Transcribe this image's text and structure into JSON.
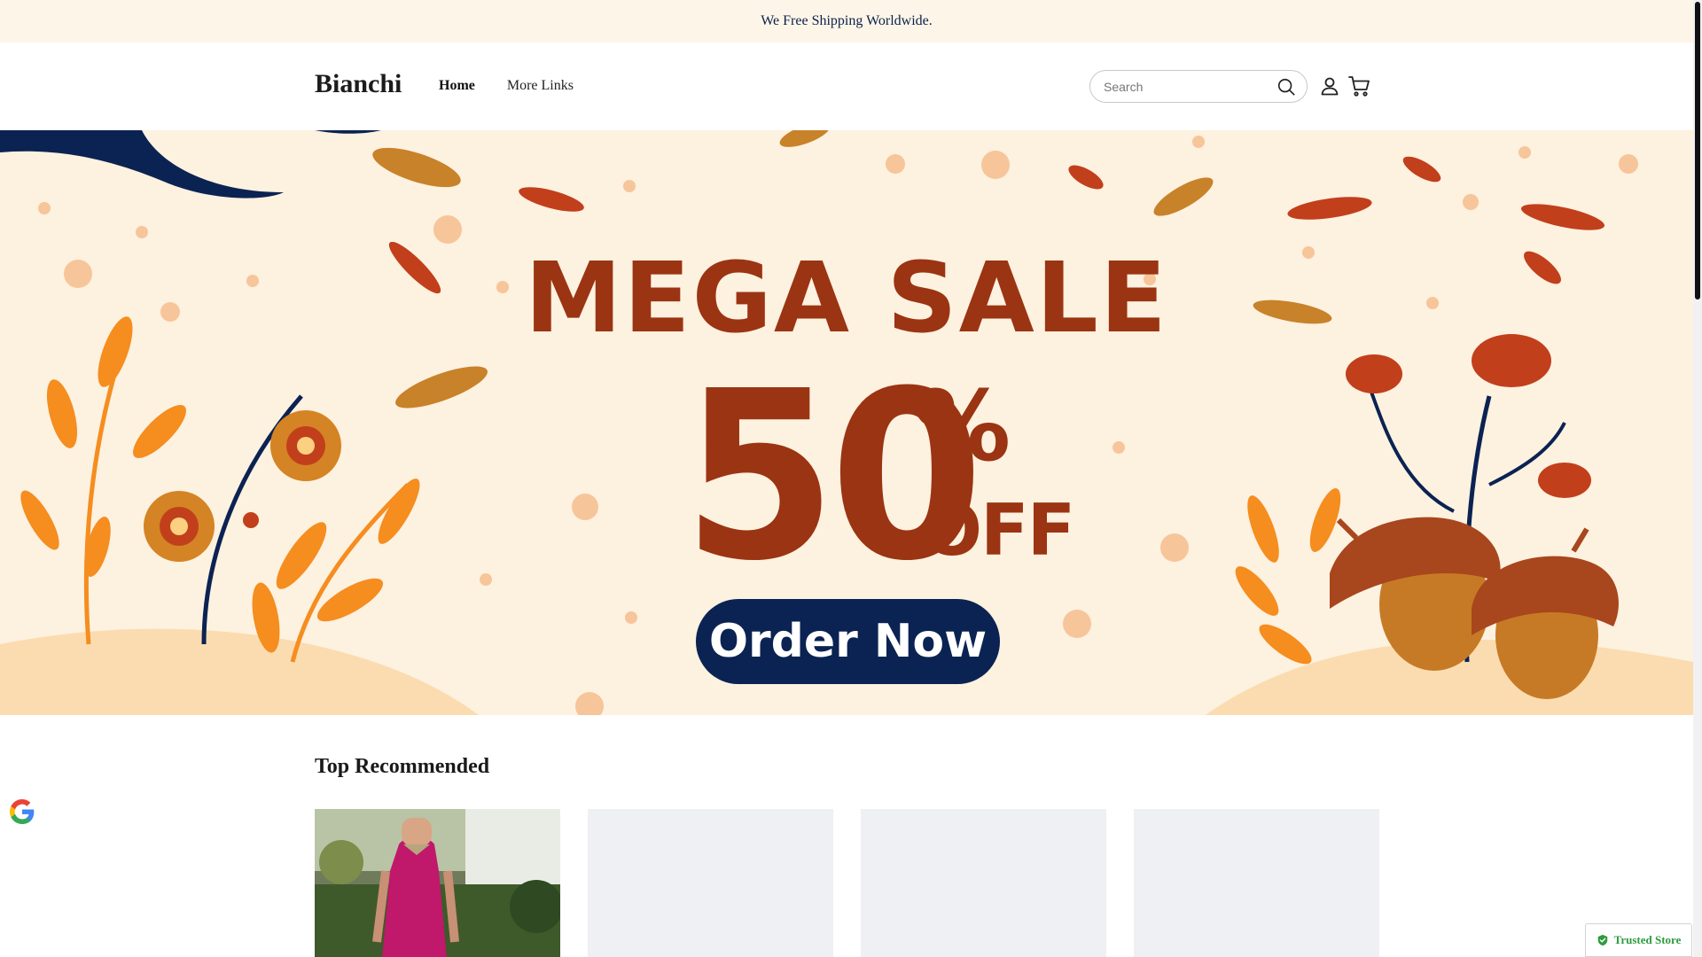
{
  "announcement": {
    "text": "We Free Shipping Worldwide."
  },
  "header": {
    "logo": "Bianchi",
    "nav": [
      {
        "label": "Home",
        "active": true
      },
      {
        "label": "More Links",
        "active": false
      }
    ],
    "search": {
      "placeholder": "Search",
      "icon": "search-icon"
    },
    "icons": [
      "user-icon",
      "cart-icon"
    ]
  },
  "hero": {
    "title": "MEGA SALE",
    "discount": "50",
    "percent": "%",
    "off": "OFF",
    "cta": "Order Now",
    "colors": {
      "background": "#fdf1e0",
      "text": "#9b3412",
      "button": "#0b2352"
    }
  },
  "recommended": {
    "title": "Top Recommended",
    "cards": [
      {
        "state": "image"
      },
      {
        "state": "loading"
      },
      {
        "state": "loading"
      },
      {
        "state": "loading"
      }
    ]
  },
  "badges": {
    "google": "google-icon",
    "trusted_store": "Trusted Store"
  }
}
